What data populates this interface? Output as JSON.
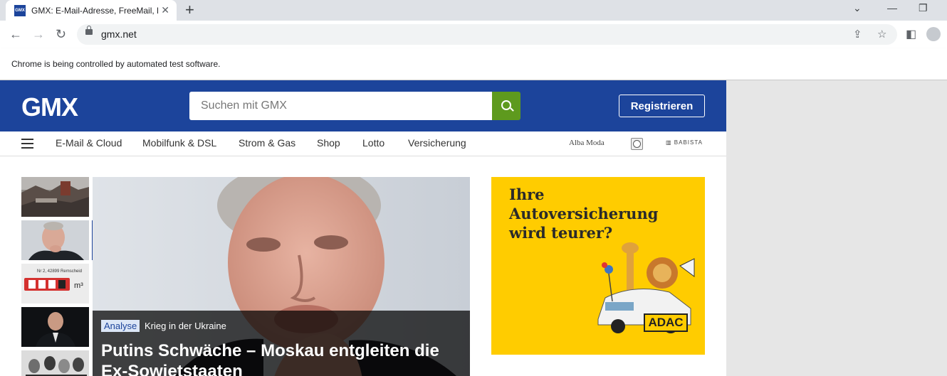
{
  "browser": {
    "tab_title": "GMX: E-Mail-Adresse, FreeMail, D",
    "favicon_text": "GMX",
    "url": "gmx.net",
    "infobar": "Chrome is being controlled by automated test software."
  },
  "header": {
    "logo": "GMX",
    "search_placeholder": "Suchen mit GMX",
    "register_label": "Registrieren"
  },
  "nav": {
    "items": [
      "E-Mail & Cloud",
      "Mobilfunk & DSL",
      "Strom & Gas",
      "Shop",
      "Lotto",
      "Versicherung"
    ],
    "partners": [
      "Alba Moda",
      "BABISTA"
    ]
  },
  "hero": {
    "tag": "Analyse",
    "kicker": "Krieg in der Ukraine",
    "headline": "Putins Schwäche – Moskau entgleiten die Ex-Sowjetstaaten"
  },
  "thumbnail_text": {
    "meter_text": "Nr 2, 42899 Remscheid",
    "meter_unit": "m³"
  },
  "ad": {
    "headline": "Ihre Autoversicherung wird teurer?",
    "brand": "ADAC"
  },
  "colors": {
    "brand_blue": "#1c449b",
    "search_green": "#5e9a1e",
    "ad_yellow": "#ffcc00"
  }
}
